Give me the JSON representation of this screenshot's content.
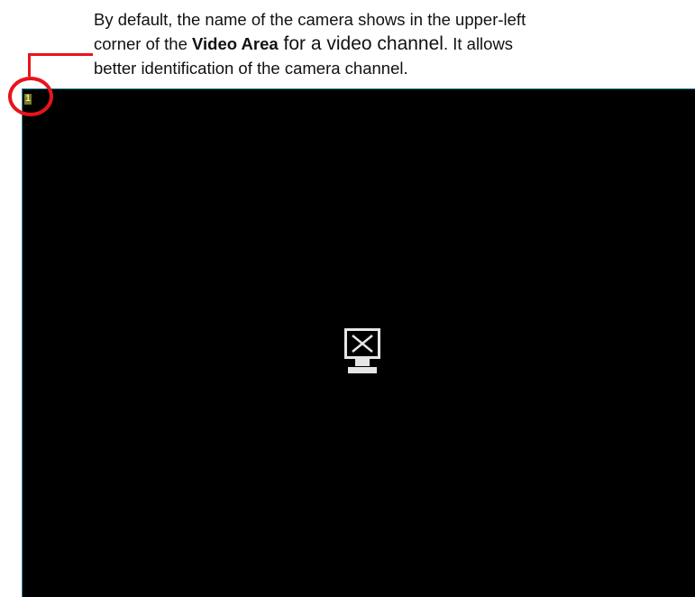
{
  "callout": {
    "line1": "By default, the name of the camera shows in the upper-left",
    "line2_pre": "corner of the ",
    "line2_bold": "Video Area",
    "line2_large": " for a video channel",
    "line2_post": ". It allows",
    "line3": "better identification of the camera channel."
  },
  "video_area": {
    "channel_label": "1",
    "status_icon": "no-signal-monitor-icon"
  },
  "colors": {
    "highlight": "#e8141b",
    "video_background": "#000000",
    "channel_label_bg": "#7a7a2c",
    "channel_label_text": "#f2f27a",
    "video_border": "#2e8ea8"
  }
}
